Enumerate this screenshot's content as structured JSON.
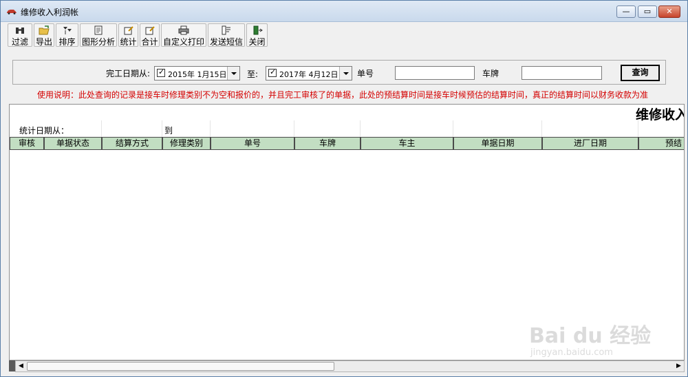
{
  "window": {
    "title": "维修收入利润帐",
    "accent_color": "#c0392b"
  },
  "toolbar": {
    "buttons": [
      {
        "label": "过滤",
        "icon": "binoculars-icon"
      },
      {
        "label": "导出",
        "icon": "export-folder-icon"
      },
      {
        "label": "排序",
        "icon": "sort-icon"
      },
      {
        "label": "图形分析",
        "icon": "document-icon"
      },
      {
        "label": "统计",
        "icon": "edit-note-icon"
      },
      {
        "label": "合计",
        "icon": "edit-note-icon"
      },
      {
        "label": "自定义打印",
        "icon": "printer-icon"
      },
      {
        "label": "发送短信",
        "icon": "message-list-icon"
      },
      {
        "label": "关闭",
        "icon": "exit-door-icon"
      }
    ]
  },
  "query": {
    "date_from_label": "完工日期从:",
    "date_from": "2015年  1月15日",
    "to_label": "至:",
    "date_to": "2017年  4月12日",
    "order_no_label": "单号",
    "order_no_value": "",
    "plate_label": "车牌",
    "plate_value": "",
    "search_button": "查询"
  },
  "notice": "使用说明：此处查询的记录是接车时修理类别不为空和报价的，并且完工审核了的单据，此处的预结算时间是接车时候预估的结算时间，真正的结算时间以财务收款为准",
  "report": {
    "title": "维修收入",
    "stat_date_label": "统计日期从：",
    "stat_to_label": "到",
    "header_color": "#c2dec2",
    "columns": [
      "审核",
      "单据状态",
      "结算方式",
      "修理类别",
      "单号",
      "车牌",
      "车主",
      "单据日期",
      "进厂日期",
      "预结"
    ]
  },
  "watermark": {
    "brand": "Bai du 经验",
    "url": "jingyan.baidu.com"
  }
}
